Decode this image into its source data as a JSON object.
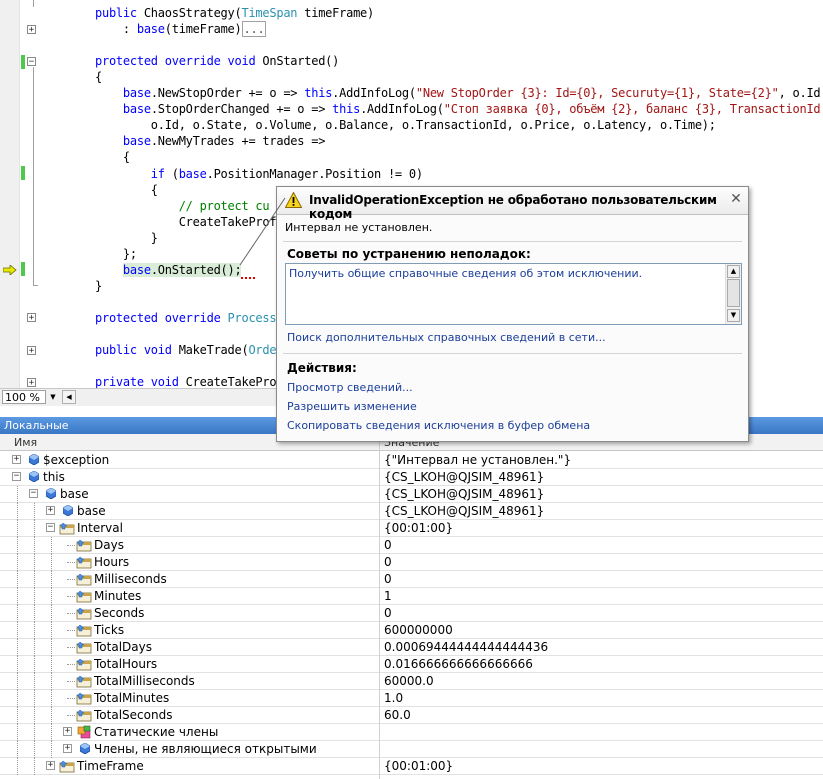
{
  "code": {
    "lines": [
      {
        "parts": [
          {
            "t": "public ",
            "c": "kw"
          },
          {
            "t": "ChaosStrategy("
          },
          {
            "t": "TimeSpan",
            "c": "ty"
          },
          {
            "t": " timeFrame)"
          }
        ]
      },
      {
        "parts": [
          {
            "t": "    : "
          },
          {
            "t": "base",
            "c": "kw"
          },
          {
            "t": "(timeFrame)"
          },
          {
            "t": "...",
            "c": "collapsed"
          }
        ]
      },
      {
        "parts": []
      },
      {
        "parts": [
          {
            "t": "protected override void ",
            "c": "kw"
          },
          {
            "t": "OnStarted()"
          }
        ]
      },
      {
        "parts": [
          {
            "t": "{"
          }
        ]
      },
      {
        "parts": [
          {
            "t": "    "
          },
          {
            "t": "base",
            "c": "kw"
          },
          {
            "t": ".NewStopOrder += o => "
          },
          {
            "t": "this",
            "c": "kw"
          },
          {
            "t": ".AddInfoLog("
          },
          {
            "t": "\"New StopOrder {3}: Id={0}, Securuty={1}, State={2}\"",
            "c": "st"
          },
          {
            "t": ", o.Id"
          }
        ]
      },
      {
        "parts": [
          {
            "t": "    "
          },
          {
            "t": "base",
            "c": "kw"
          },
          {
            "t": ".StopOrderChanged += o => "
          },
          {
            "t": "this",
            "c": "kw"
          },
          {
            "t": ".AddInfoLog("
          },
          {
            "t": "\"Стоп заявка {0}, объём {2}, баланс {3}, TransactionId",
            "c": "st"
          }
        ]
      },
      {
        "parts": [
          {
            "t": "        o.Id, o.State, o.Volume, o.Balance, o.TransactionId, o.Price, o.Latency, o.Time);"
          }
        ]
      },
      {
        "parts": [
          {
            "t": "    "
          },
          {
            "t": "base",
            "c": "kw"
          },
          {
            "t": ".NewMyTrades += trades =>"
          }
        ]
      },
      {
        "parts": [
          {
            "t": "    {"
          }
        ]
      },
      {
        "parts": [
          {
            "t": "        "
          },
          {
            "t": "if",
            "c": "kw"
          },
          {
            "t": " ("
          },
          {
            "t": "base",
            "c": "kw"
          },
          {
            "t": ".PositionManager.Position != 0)"
          }
        ]
      },
      {
        "parts": [
          {
            "t": "        {"
          }
        ]
      },
      {
        "parts": [
          {
            "t": "            "
          },
          {
            "t": "// protect cu",
            "c": "cm"
          }
        ]
      },
      {
        "parts": [
          {
            "t": "            CreateTakeProf"
          }
        ]
      },
      {
        "parts": [
          {
            "t": "        }"
          }
        ]
      },
      {
        "parts": [
          {
            "t": "    };"
          }
        ]
      },
      {
        "parts": [
          {
            "t": "    "
          },
          {
            "t": "base",
            "c": "kw"
          },
          {
            "t": ".OnStarted();"
          }
        ],
        "current": true
      },
      {
        "parts": [
          {
            "t": "}"
          }
        ]
      },
      {
        "parts": []
      },
      {
        "parts": [
          {
            "t": "protected override ",
            "c": "kw"
          },
          {
            "t": "Process",
            "c": "ty"
          }
        ]
      },
      {
        "parts": []
      },
      {
        "parts": [
          {
            "t": "public void ",
            "c": "kw"
          },
          {
            "t": "MakeTrade("
          },
          {
            "t": "Orde",
            "c": "ty"
          }
        ]
      },
      {
        "parts": []
      },
      {
        "parts": [
          {
            "t": "private void ",
            "c": "kw"
          },
          {
            "t": "CreateTakePro"
          }
        ]
      }
    ]
  },
  "zoom": "100 %",
  "popup": {
    "title": "InvalidOperationException не обработано пользовательским кодом",
    "message": "Интервал не установлен.",
    "tips_heading": "Советы по устранению неполадок:",
    "tips_link": "Получить общие справочные сведения об этом исключении.",
    "search_link": "Поиск дополнительных справочных сведений в сети...",
    "actions_heading": "Действия:",
    "actions": [
      "Просмотр сведений...",
      "Разрешить изменение",
      "Скопировать сведения исключения в буфер обмена"
    ]
  },
  "locals": {
    "title": "Локальные",
    "col_name": "Имя",
    "col_value": "Значение",
    "rows": [
      {
        "name": "$exception",
        "value": "{\"Интервал не установлен.\"}",
        "level": 0,
        "exp": "+",
        "icon": "field"
      },
      {
        "name": "this",
        "value": "{CS_LKOH@QJSIM_48961}",
        "level": 0,
        "exp": "-",
        "icon": "field"
      },
      {
        "name": "base",
        "value": "{CS_LKOH@QJSIM_48961}",
        "level": 1,
        "exp": "-",
        "icon": "field"
      },
      {
        "name": "base",
        "value": "{CS_LKOH@QJSIM_48961}",
        "level": 2,
        "exp": "+",
        "icon": "field"
      },
      {
        "name": "Interval",
        "value": "{00:01:00}",
        "level": 2,
        "exp": "-",
        "icon": "prop"
      },
      {
        "name": "Days",
        "value": "0",
        "level": 3,
        "exp": "",
        "icon": "prop"
      },
      {
        "name": "Hours",
        "value": "0",
        "level": 3,
        "exp": "",
        "icon": "prop"
      },
      {
        "name": "Milliseconds",
        "value": "0",
        "level": 3,
        "exp": "",
        "icon": "prop"
      },
      {
        "name": "Minutes",
        "value": "1",
        "level": 3,
        "exp": "",
        "icon": "prop"
      },
      {
        "name": "Seconds",
        "value": "0",
        "level": 3,
        "exp": "",
        "icon": "prop"
      },
      {
        "name": "Ticks",
        "value": "600000000",
        "level": 3,
        "exp": "",
        "icon": "prop"
      },
      {
        "name": "TotalDays",
        "value": "0.00069444444444444436",
        "level": 3,
        "exp": "",
        "icon": "prop"
      },
      {
        "name": "TotalHours",
        "value": "0.016666666666666666",
        "level": 3,
        "exp": "",
        "icon": "prop"
      },
      {
        "name": "TotalMilliseconds",
        "value": "60000.0",
        "level": 3,
        "exp": "",
        "icon": "prop"
      },
      {
        "name": "TotalMinutes",
        "value": "1.0",
        "level": 3,
        "exp": "",
        "icon": "prop"
      },
      {
        "name": "TotalSeconds",
        "value": "60.0",
        "level": 3,
        "exp": "",
        "icon": "prop"
      },
      {
        "name": "Статические члены",
        "value": "",
        "level": 3,
        "exp": "+",
        "icon": "static"
      },
      {
        "name": "Члены, не являющиеся открытыми",
        "value": "",
        "level": 3,
        "exp": "+",
        "icon": "field"
      },
      {
        "name": "TimeFrame",
        "value": "{00:01:00}",
        "level": 2,
        "exp": "+",
        "icon": "prop"
      }
    ]
  }
}
